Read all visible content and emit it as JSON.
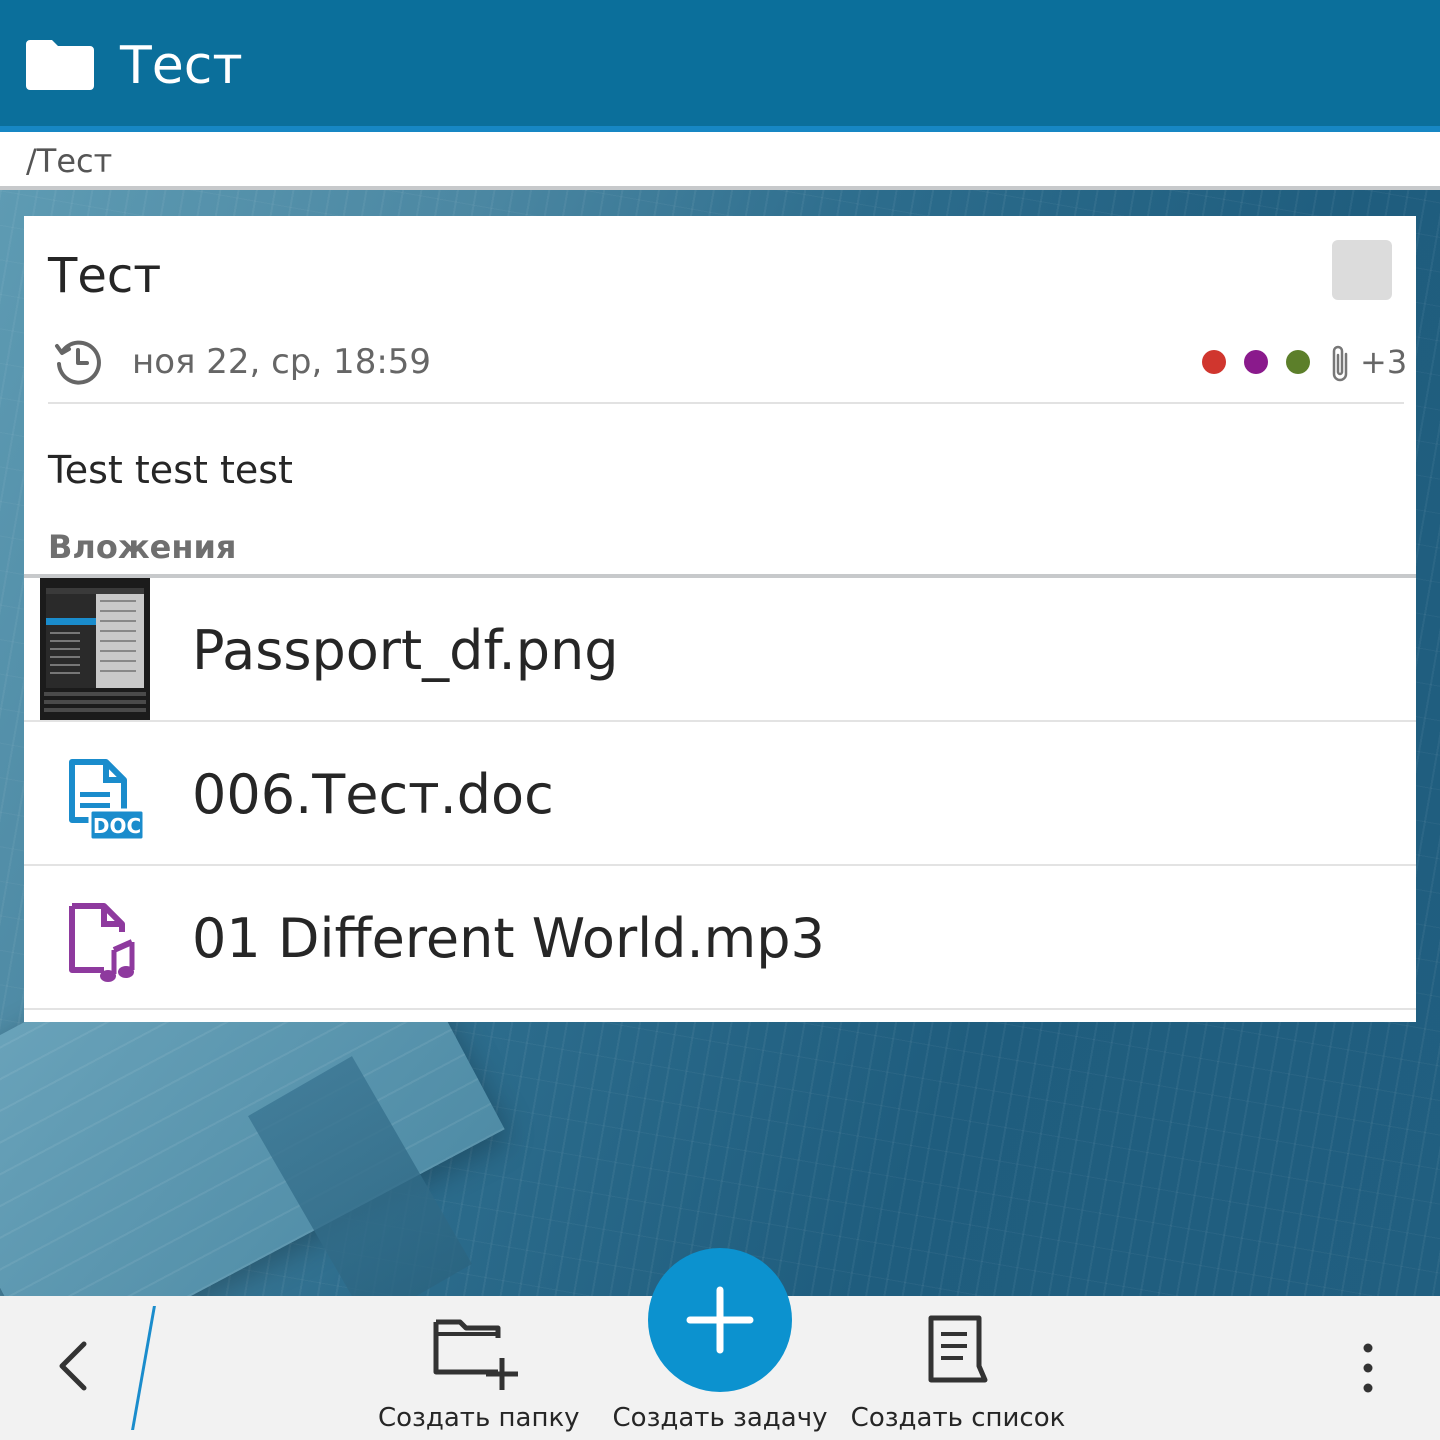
{
  "header": {
    "title": "Тест",
    "icon": "folder-icon"
  },
  "breadcrumb": {
    "path": "/Тест"
  },
  "note": {
    "title": "Тест",
    "date": "ноя 22, ср, 18:59",
    "tag_colors": [
      "#d0362e",
      "#8a1a8c",
      "#5c7f2a"
    ],
    "attachments_extra": "+3",
    "body": "Test test test",
    "attachments_label": "Вложения",
    "attachments": [
      {
        "name": "Passport_df.png",
        "icon": "image-thumbnail"
      },
      {
        "name": "006.Тест.doc",
        "icon": "doc-file-icon",
        "badge": "DOC",
        "color": "#1a8ccc"
      },
      {
        "name": "01 Different World.mp3",
        "icon": "audio-file-icon",
        "color": "#8e3a9e"
      }
    ]
  },
  "actionbar": {
    "create_folder": "Создать папку",
    "create_task": "Создать задачу",
    "create_list": "Создать список"
  },
  "colors": {
    "accent": "#0c92cf",
    "header": "#0b6f9b"
  }
}
